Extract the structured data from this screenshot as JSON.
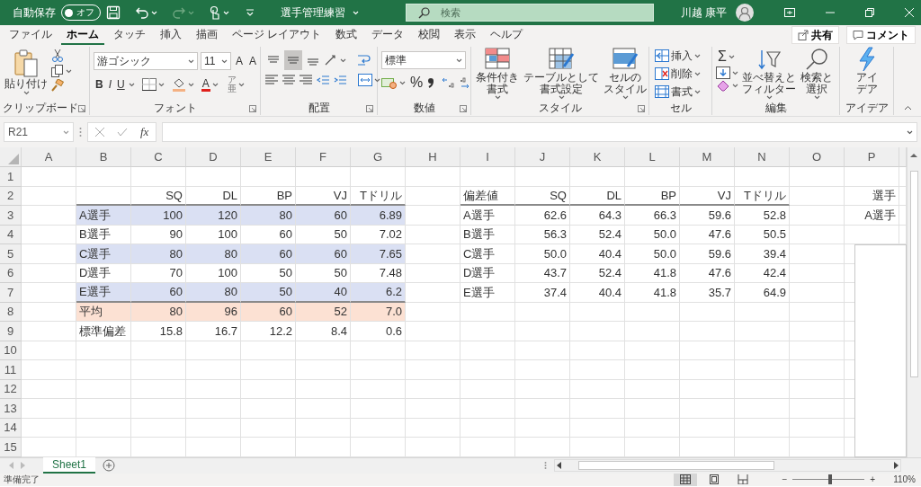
{
  "title_bar": {
    "autosave_label": "自動保存",
    "autosave_toggle": {
      "text": "オフ",
      "on": false
    },
    "document_title": "選手管理練習",
    "search_placeholder": "検索",
    "user_name": "川越 康平"
  },
  "ribbon_tabs": [
    {
      "label": "ファイル",
      "selected": false
    },
    {
      "label": "ホーム",
      "selected": true
    },
    {
      "label": "タッチ",
      "selected": false
    },
    {
      "label": "挿入",
      "selected": false
    },
    {
      "label": "描画",
      "selected": false
    },
    {
      "label": "ページ レイアウト",
      "selected": false
    },
    {
      "label": "数式",
      "selected": false
    },
    {
      "label": "データ",
      "selected": false
    },
    {
      "label": "校閲",
      "selected": false
    },
    {
      "label": "表示",
      "selected": false
    },
    {
      "label": "ヘルプ",
      "selected": false
    }
  ],
  "share_button": "共有",
  "comment_button": "コメント",
  "ribbon": {
    "clipboard": {
      "paste": "貼り付け",
      "label": "クリップボード"
    },
    "font": {
      "name": "游ゴシック",
      "size": "11",
      "grow": "A",
      "shrink": "A",
      "bold": "B",
      "italic": "I",
      "underline": "U",
      "font_color": "A",
      "phonetic_top": "ア",
      "phonetic_bottom": "亜",
      "label": "フォント"
    },
    "alignment": {
      "vertical": [
        {
          "kind": "top",
          "selected": false
        },
        {
          "kind": "middle",
          "selected": true
        },
        {
          "kind": "bottom",
          "selected": false
        }
      ],
      "label": "配置"
    },
    "number": {
      "format": "標準",
      "percent": "%",
      "label": "数値"
    },
    "styles": {
      "conditional": [
        "条件付き",
        "書式"
      ],
      "table": [
        "テーブルとして",
        "書式設定"
      ],
      "cell_styles": [
        "セルの",
        "スタイル"
      ],
      "label": "スタイル"
    },
    "cells": {
      "items": [
        "挿入",
        "削除",
        "書式"
      ],
      "label": "セル"
    },
    "editing": {
      "autosum": "Σ",
      "sort": [
        "並べ替えと",
        "フィルター"
      ],
      "find": [
        "検索と",
        "選択"
      ],
      "label": "編集"
    },
    "ideas": {
      "button": [
        "アイ",
        "デア"
      ],
      "label": "アイデア"
    }
  },
  "formula_bar": {
    "name_box": "R21",
    "function_label": "fx"
  },
  "sheet": {
    "columns": [
      {
        "label": "A"
      },
      {
        "label": "B",
        "left_aligned": true,
        "left_table": true
      },
      {
        "label": "C",
        "left_table": true
      },
      {
        "label": "D",
        "left_table": true
      },
      {
        "label": "E",
        "left_table": true
      },
      {
        "label": "F",
        "left_table": true
      },
      {
        "label": "G",
        "left_table": true
      },
      {
        "label": "H"
      },
      {
        "label": "I",
        "left_aligned": true,
        "right_table": true
      },
      {
        "label": "J",
        "right_table": true
      },
      {
        "label": "K",
        "right_table": true
      },
      {
        "label": "L",
        "right_table": true
      },
      {
        "label": "M",
        "right_table": true
      },
      {
        "label": "N",
        "right_table": true
      },
      {
        "label": "O"
      },
      {
        "label": "P"
      }
    ],
    "rows": [
      {
        "number": "1",
        "cells": {}
      },
      {
        "number": "2",
        "cells": {
          "C": "SQ",
          "D": "DL",
          "E": "BP",
          "F": "VJ",
          "G": "Tドリル",
          "I": "偏差値",
          "J": "SQ",
          "K": "DL",
          "L": "BP",
          "M": "VJ",
          "N": "Tドリル",
          "P": "選手"
        },
        "rule_below": {
          "left": true,
          "right": true
        }
      },
      {
        "number": "3",
        "cells": {
          "B": "A選手",
          "C": "100",
          "D": "120",
          "E": "80",
          "F": "60",
          "G": "6.89",
          "I": "A選手",
          "J": "62.6",
          "K": "64.3",
          "L": "66.3",
          "M": "59.6",
          "N": "52.8",
          "P": "A選手"
        },
        "fill": {
          "color": "#dae0f3"
        }
      },
      {
        "number": "4",
        "cells": {
          "B": "B選手",
          "C": "90",
          "D": "100",
          "E": "60",
          "F": "50",
          "G": "7.02",
          "I": "B選手",
          "J": "56.3",
          "K": "52.4",
          "L": "50.0",
          "M": "47.6",
          "N": "50.5"
        }
      },
      {
        "number": "5",
        "cells": {
          "B": "C選手",
          "C": "80",
          "D": "80",
          "E": "60",
          "F": "60",
          "G": "7.65",
          "I": "C選手",
          "J": "50.0",
          "K": "40.4",
          "L": "50.0",
          "M": "59.6",
          "N": "39.4"
        },
        "fill": {
          "color": "#dae0f3"
        }
      },
      {
        "number": "6",
        "cells": {
          "B": "D選手",
          "C": "70",
          "D": "100",
          "E": "50",
          "F": "50",
          "G": "7.48",
          "I": "D選手",
          "J": "43.7",
          "K": "52.4",
          "L": "41.8",
          "M": "47.6",
          "N": "42.4"
        }
      },
      {
        "number": "7",
        "cells": {
          "B": "E選手",
          "C": "60",
          "D": "80",
          "E": "50",
          "F": "40",
          "G": "6.2",
          "I": "E選手",
          "J": "37.4",
          "K": "40.4",
          "L": "41.8",
          "M": "35.7",
          "N": "64.9"
        },
        "fill": {
          "color": "#dae0f3"
        },
        "rule_below": {
          "left": true
        }
      },
      {
        "number": "8",
        "cells": {
          "B": "平均",
          "C": "80",
          "D": "96",
          "E": "60",
          "F": "52",
          "G": "7.0"
        },
        "fill": {
          "color": "#fce1d3"
        }
      },
      {
        "number": "9",
        "cells": {
          "B": "標準偏差",
          "C": "15.8",
          "D": "16.7",
          "E": "12.2",
          "F": "8.4",
          "G": "0.6"
        }
      },
      {
        "number": "10",
        "cells": {}
      },
      {
        "number": "11",
        "cells": {}
      },
      {
        "number": "12",
        "cells": {}
      },
      {
        "number": "13",
        "cells": {}
      },
      {
        "number": "14",
        "cells": {}
      },
      {
        "number": "15",
        "cells": {}
      }
    ]
  },
  "sheet_tabs": [
    {
      "label": "Sheet1",
      "selected": true
    }
  ],
  "status_bar": {
    "status": "準備完了",
    "views": [
      {
        "kind": "normal",
        "selected": true
      },
      {
        "kind": "page_layout",
        "selected": false
      },
      {
        "kind": "page_break",
        "selected": false
      }
    ],
    "zoom_out": "−",
    "zoom_in": "+",
    "zoom": {
      "level": 0.52
    },
    "zoom_text": "110%"
  }
}
